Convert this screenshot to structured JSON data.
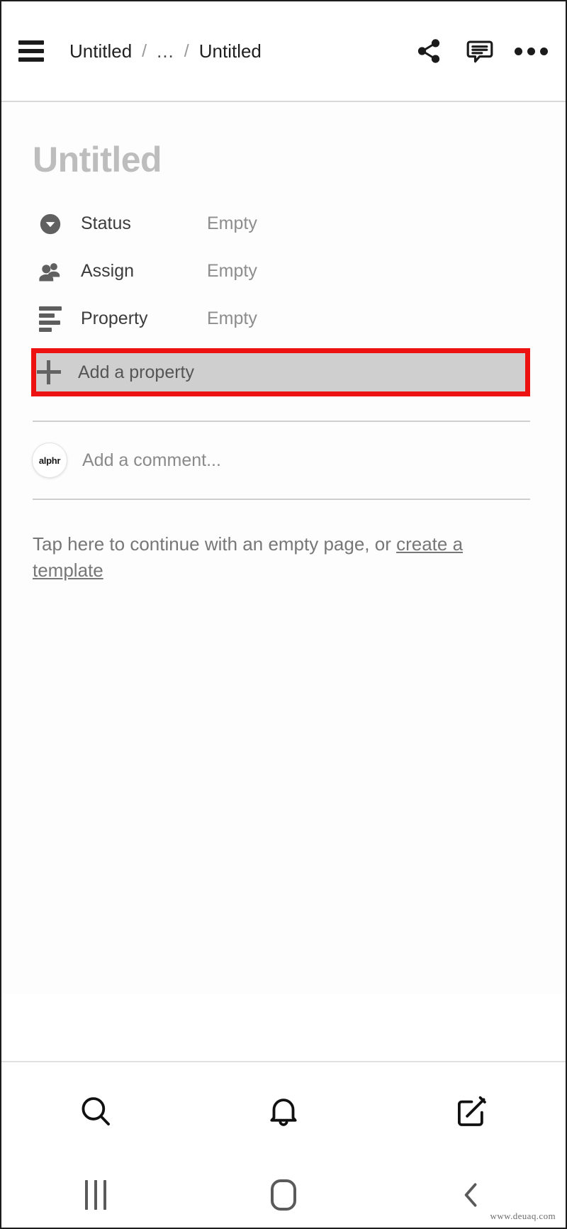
{
  "header": {
    "menu_icon": "hamburger-menu-icon",
    "breadcrumb": {
      "first": "Untitled",
      "sep1": "/",
      "middle": "...",
      "sep2": "/",
      "current": "Untitled"
    },
    "actions": [
      {
        "name": "share-icon",
        "label": "Share"
      },
      {
        "name": "comment-icon",
        "label": "Comments"
      },
      {
        "name": "more-options-icon",
        "label": "More"
      }
    ]
  },
  "page": {
    "title": "Untitled",
    "title_color": "#bdbdbd",
    "properties": [
      {
        "icon": "status-circle-chevron-icon",
        "label": "Status",
        "value": "Empty"
      },
      {
        "icon": "assign-people-icon",
        "label": "Assign",
        "value": "Empty"
      },
      {
        "icon": "property-lines-icon",
        "label": "Property",
        "value": "Empty"
      }
    ],
    "add_property": {
      "icon": "plus-icon",
      "label": "Add a property",
      "highlight_color": "#ee1111",
      "background_color": "#cfcfcf"
    },
    "comment": {
      "avatar_text": "alphr",
      "placeholder": "Add a comment..."
    },
    "empty_state": {
      "text": "Tap here to continue with an empty page, or ",
      "link": "create a template"
    }
  },
  "tabbar": {
    "tabs": [
      {
        "name": "tab-search",
        "icon": "search-icon"
      },
      {
        "name": "tab-notifications",
        "icon": "bell-icon"
      },
      {
        "name": "tab-new-page",
        "icon": "compose-edit-icon"
      }
    ]
  },
  "navbar": {
    "buttons": [
      {
        "name": "nav-recents",
        "icon": "recent-apps-icon"
      },
      {
        "name": "nav-home",
        "icon": "home-icon"
      },
      {
        "name": "nav-back",
        "icon": "back-chevron-icon"
      }
    ]
  },
  "watermark": "www.deuaq.com"
}
